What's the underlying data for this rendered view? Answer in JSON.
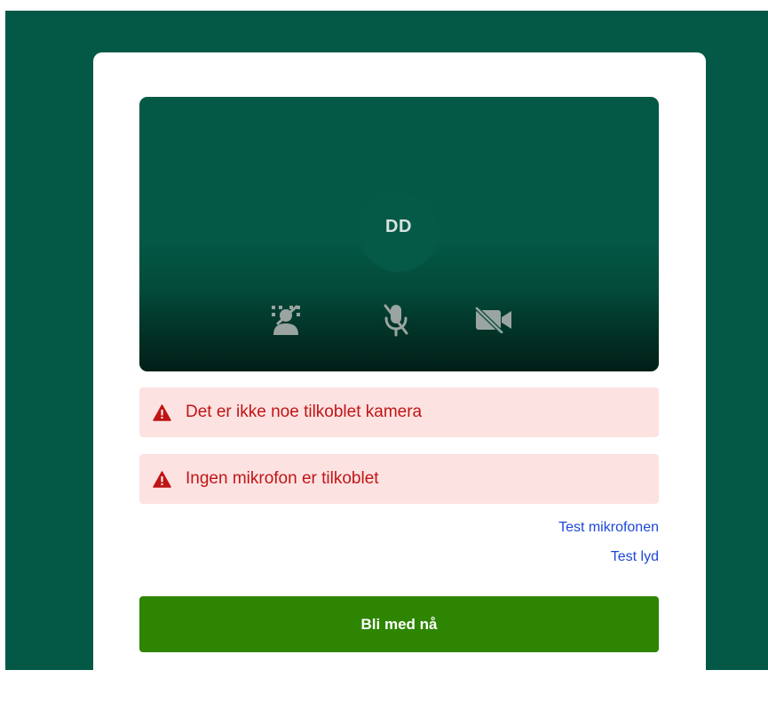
{
  "preview": {
    "initials": "DD"
  },
  "controls": {
    "background_icon": "background-blur-off-icon",
    "mic_icon": "microphone-off-icon",
    "camera_icon": "video-camera-off-icon"
  },
  "alerts": {
    "camera": "Det er ikke noe tilkoblet kamera",
    "microphone": "Ingen mikrofon er tilkoblet",
    "icon": "warning-triangle-icon"
  },
  "links": {
    "test_microphone": "Test mikrofonen",
    "test_sound": "Test lyd"
  },
  "join": {
    "label": "Bli med nå"
  },
  "colors": {
    "page_background": "#045946",
    "card": "#ffffff",
    "alert_background": "#fde2e2",
    "alert_text": "#c01515",
    "link": "#1c47d8",
    "join_button": "#2e8501"
  }
}
